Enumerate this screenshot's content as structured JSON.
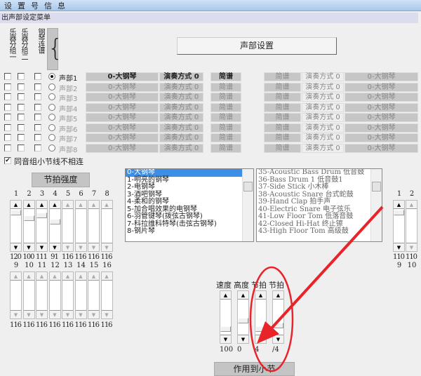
{
  "menubar": {
    "items": [
      "设",
      "置",
      "号",
      "信",
      "息"
    ]
  },
  "subbar": {
    "title": "出声部设定菜单"
  },
  "vertical_labels": [
    "乐器分组一",
    "乐器分组二",
    "钢琴连谱"
  ],
  "brace_button": "{",
  "voice_setting_button": "声部设置",
  "voices": [
    {
      "label": "声部1",
      "instrument": "0-大钢琴",
      "play_mode": "演奏方式 0",
      "notation": "简谱",
      "selected": true
    },
    {
      "label": "声部2",
      "instrument": "0-大钢琴",
      "play_mode": "演奏方式 0",
      "notation": "简谱",
      "selected": false
    },
    {
      "label": "声部3",
      "instrument": "0-大钢琴",
      "play_mode": "演奏方式 0",
      "notation": "简谱",
      "selected": false
    },
    {
      "label": "声部4",
      "instrument": "0-大钢琴",
      "play_mode": "演奏方式 0",
      "notation": "简谱",
      "selected": false
    },
    {
      "label": "声部5",
      "instrument": "0-大钢琴",
      "play_mode": "演奏方式 0",
      "notation": "简谱",
      "selected": false
    },
    {
      "label": "声部6",
      "instrument": "0-大钢琴",
      "play_mode": "演奏方式 0",
      "notation": "简谱",
      "selected": false
    },
    {
      "label": "声部7",
      "instrument": "0-大钢琴",
      "play_mode": "演奏方式 0",
      "notation": "简谱",
      "selected": false
    },
    {
      "label": "声部8",
      "instrument": "0-大钢琴",
      "play_mode": "演奏方式 0",
      "notation": "简谱",
      "selected": false
    }
  ],
  "same_group_checkbox": "同音组小节线不相连",
  "beat_strength": {
    "title": "节拍强度",
    "row1": {
      "labels": [
        "1",
        "2",
        "3",
        "4",
        "5",
        "6",
        "7",
        "8"
      ],
      "values": [
        "120",
        "100",
        "111",
        "91",
        "116",
        "116",
        "116",
        "116"
      ]
    },
    "row2": {
      "labels": [
        "9",
        "10",
        "11",
        "12",
        "13",
        "14",
        "15",
        "16"
      ],
      "values": [
        "116",
        "116",
        "116",
        "116",
        "116",
        "116",
        "116",
        "116"
      ]
    }
  },
  "instrument_list": [
    "0-大钢琴",
    "1-明亮的钢琴",
    "2-电钢琴",
    "3-酒吧钢琴",
    "4-柔和的钢琴",
    "5-加合唱效果的电钢琴",
    "6-羽管键琴(拨弦古钢琴)",
    "7-科拉维科特琴(击弦古钢琴)",
    "8-钢片琴"
  ],
  "drum_list": [
    "35-Acoustic Bass Drum 低音鼓",
    "36-Bass Drum 1 低音鼓1",
    "37-Side Stick 小木棒",
    "38-Acoustic Snare 台式蛇鼓",
    "39-Hand Clap 拍手声",
    "40-Electric Snare 电子弦乐",
    "41-Low Floor Tom 低落音鼓",
    "42-Closed Hi-Hat 终止镲",
    "43-High Floor Tom 高级鼓"
  ],
  "right_sliders": {
    "labels": [
      "1",
      "2"
    ],
    "values": [
      "110",
      "110"
    ],
    "next_labels": [
      "9",
      "10"
    ]
  },
  "params": [
    {
      "label": "速度",
      "value": "100"
    },
    {
      "label": "高度",
      "value": "0"
    },
    {
      "label": "节拍",
      "value": "4"
    },
    {
      "label": "节拍",
      "value": "/4"
    }
  ],
  "apply_button": "作用到小节",
  "annotation_color": "#e8242a"
}
